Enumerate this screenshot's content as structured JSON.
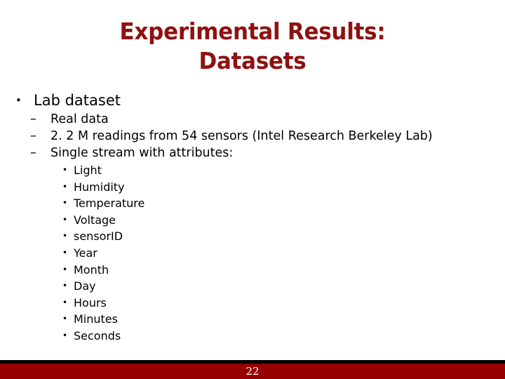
{
  "slide": {
    "background_color": "#ffffff",
    "title": {
      "color": "#8f1111",
      "line1": "Experimental Results:",
      "line2": "Datasets"
    },
    "body": {
      "level1": {
        "bullet_glyph": "•",
        "text": "Lab dataset"
      },
      "level2": {
        "bullet_glyph": "–",
        "items": [
          "Real data",
          "2. 2 M readings from 54 sensors (Intel Research Berkeley Lab)",
          "Single stream with attributes:"
        ]
      },
      "level3": {
        "bullet_glyph": "•",
        "items": [
          "Light",
          "Humidity",
          "Temperature",
          "Voltage",
          "sensorID",
          "Year",
          "Month",
          "Day",
          "Hours",
          "Minutes",
          "Seconds"
        ]
      }
    },
    "footer": {
      "rule_color": "#000000",
      "bar_color": "#960000",
      "page_number": "22"
    }
  }
}
